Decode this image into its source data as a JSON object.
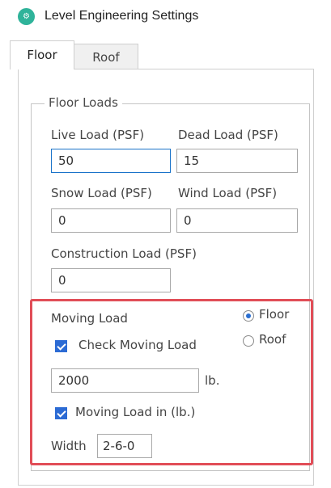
{
  "window": {
    "title": "Level Engineering Settings",
    "app_icon": "engineering-app-icon"
  },
  "tabs": [
    {
      "label": "Floor",
      "active": true
    },
    {
      "label": "Roof",
      "active": false
    }
  ],
  "floor_loads": {
    "legend": "Floor Loads",
    "live_load": {
      "label": "Live Load (PSF)",
      "value": "50"
    },
    "dead_load": {
      "label": "Dead Load (PSF)",
      "value": "15"
    },
    "snow_load": {
      "label": "Snow Load (PSF)",
      "value": "0"
    },
    "wind_load": {
      "label": "Wind Load (PSF)",
      "value": "0"
    },
    "construction_load": {
      "label": "Construction Load (PSF)",
      "value": "0"
    }
  },
  "moving_load": {
    "label": "Moving Load",
    "location_options": [
      {
        "label": "Floor",
        "selected": true
      },
      {
        "label": "Roof",
        "selected": false
      }
    ],
    "check_moving_load": {
      "label": "Check Moving Load",
      "checked": true
    },
    "weight": {
      "value": "2000",
      "unit": "lb."
    },
    "moving_load_in_lb": {
      "label": "Moving Load in (lb.)",
      "checked": true
    },
    "width": {
      "label": "Width",
      "value": "2-6-0"
    }
  },
  "colors": {
    "accent": "#2c6bd4",
    "highlight_border": "#e14d57",
    "app_icon": "#2fb39a"
  }
}
